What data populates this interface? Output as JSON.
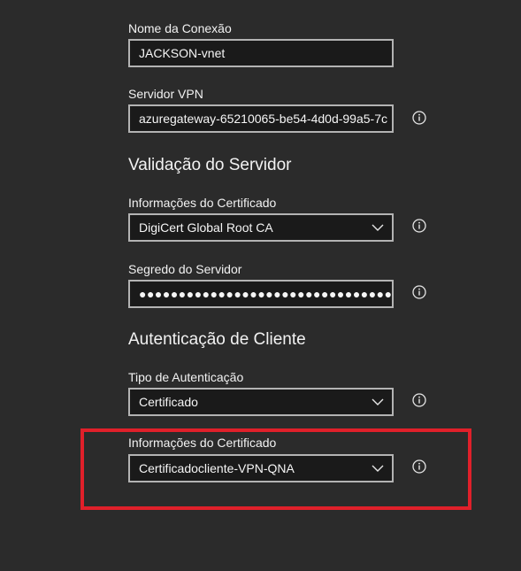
{
  "connection_name": {
    "label": "Nome da Conexão",
    "value": "JACKSON-vnet"
  },
  "vpn_server": {
    "label": "Servidor VPN",
    "value": "azuregateway-65210065-be54-4d0d-99a5-7c"
  },
  "server_validation": {
    "heading": "Validação do Servidor",
    "certificate_info": {
      "label": "Informações do Certificado",
      "value": "DigiCert Global Root CA"
    },
    "server_secret": {
      "label": "Segredo do Servidor",
      "value": "●●●●●●●●●●●●●●●●●●●●●●●●●●●●●●●●●●●●●●●●"
    }
  },
  "client_auth": {
    "heading": "Autenticação de Cliente",
    "auth_type": {
      "label": "Tipo de Autenticação",
      "value": "Certificado"
    },
    "certificate_info": {
      "label": "Informações do Certificado",
      "value": "Certificadocliente-VPN-QNA"
    }
  },
  "colors": {
    "background": "#2b2b2b",
    "field_background": "#1a1a1a",
    "field_border": "#b3b3b3",
    "highlight": "#e0202a"
  },
  "icons": {
    "info": "info-icon",
    "dropdown": "chevron-down-icon"
  }
}
